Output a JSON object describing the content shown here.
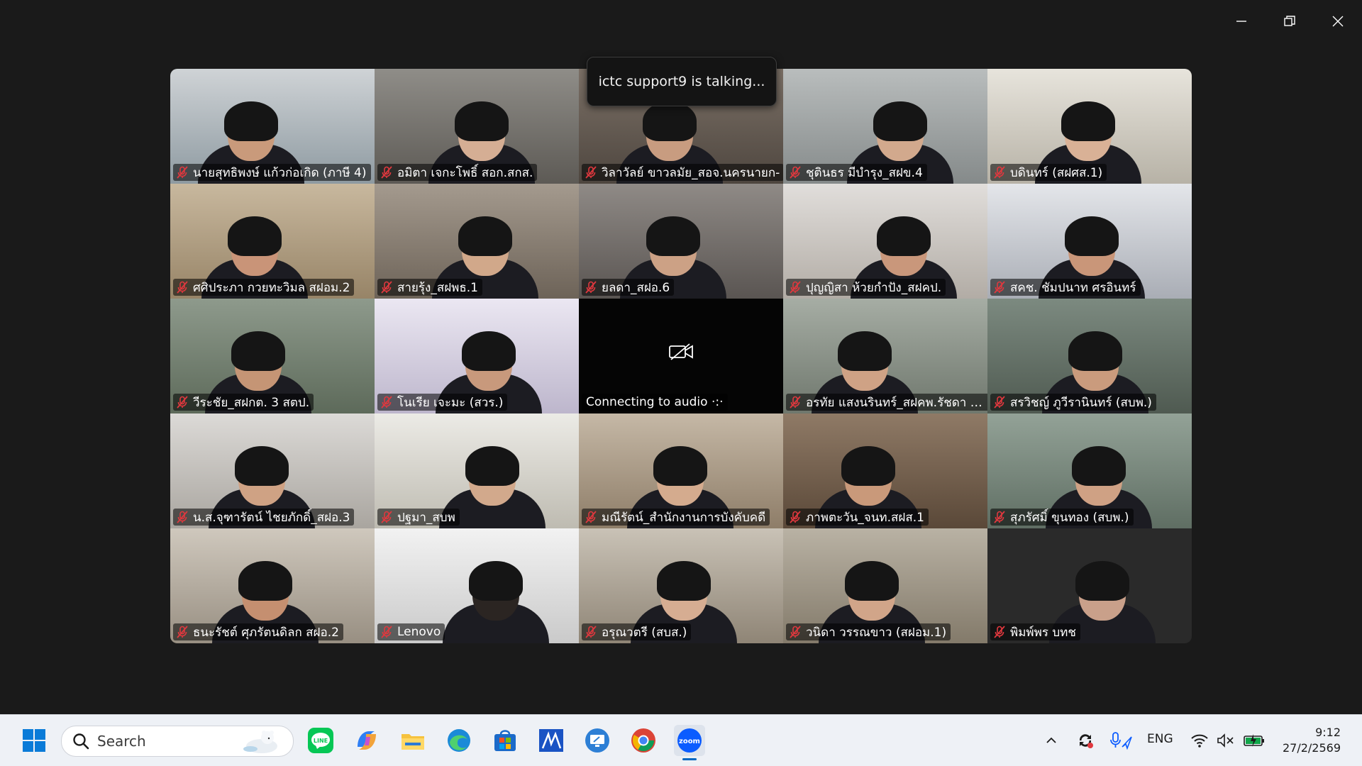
{
  "window": {
    "controls": {
      "minimize": "minimize-icon",
      "restore": "restore-icon",
      "close": "close-icon"
    }
  },
  "toast": {
    "text": "ictc support9 is talking..."
  },
  "participants": [
    {
      "name": "นายสุทธิพงษ์ แก้วก่อเกิด (ภาษี 4)",
      "muted": true
    },
    {
      "name": "อมิตา เจกะโพธิ์ สอก.สกส.",
      "muted": true
    },
    {
      "name": "วิลาวัลย์ ขาวลมัย_สอจ.นครนายก-",
      "muted": true
    },
    {
      "name": "ชุตินธร มีบำรุง_สฝข.4",
      "muted": true
    },
    {
      "name": "บดินทร์ (สฝศส.1)",
      "muted": true
    },
    {
      "name": "ศศิประภา กวยทะวิมล สฝอม.2",
      "muted": true
    },
    {
      "name": "สายรุ้ง_สฝพธ.1",
      "muted": true
    },
    {
      "name": "ยลดา_สฝอ.6",
      "muted": true
    },
    {
      "name": "ปุญญิสา ห้วยกำปัง_สฝคป.",
      "muted": true
    },
    {
      "name": "สคช. ชัมปนาท ศรอินทร์",
      "muted": true
    },
    {
      "name": "วีระชัย_สฝกต. 3 สตป.",
      "muted": true
    },
    {
      "name": "โนเรีย เจะมะ (สวร.)",
      "muted": true
    },
    {
      "name": "Connecting to audio",
      "muted": false,
      "video_off": true
    },
    {
      "name": "อรทัย แสงนรินทร์_สฝคพ.รัชดา (ส...",
      "muted": true
    },
    {
      "name": "สรวิชญ์ ภูวีรานินทร์ (สบพ.)",
      "muted": true
    },
    {
      "name": "น.ส.จุฑารัตน์ ไชยภักดิ์_สฝอ.3",
      "muted": true
    },
    {
      "name": "ปฐมา_สบพ",
      "muted": true
    },
    {
      "name": "มณีรัตน์_สำนักงานการบังคับคดี",
      "muted": true
    },
    {
      "name": "ภาพตะวัน_จนท.สฝส.1",
      "muted": true
    },
    {
      "name": "สุภรัศมิ์ ขุนทอง (สบพ.)",
      "muted": true
    },
    {
      "name": "ธนะรัชต์ ศุภรัตนดิลก สฝอ.2",
      "muted": true
    },
    {
      "name": "Lenovo",
      "muted": true
    },
    {
      "name": "อรุณวตรี (สบส.)",
      "muted": true
    },
    {
      "name": "วนิดา วรรณขาว (สฝอม.1)",
      "muted": true
    },
    {
      "name": "พิมพ์พร บทช",
      "muted": true
    }
  ],
  "taskbar": {
    "search_label": "Search",
    "apps": [
      "windows-start-icon",
      "line-app-icon",
      "copilot-icon",
      "file-explorer-icon",
      "edge-browser-icon",
      "microsoft-store-icon",
      "sign-app-icon",
      "remote-desktop-icon",
      "chrome-icon",
      "zoom-icon"
    ],
    "tray": {
      "language": "ENG",
      "time": "9:12",
      "date": "27/2/2569"
    }
  },
  "colors": {
    "muted_mic": "#e0383e",
    "background": "#1a1a1a",
    "taskbar": "#eef1f6",
    "zoom_blue": "#0b5cff"
  }
}
